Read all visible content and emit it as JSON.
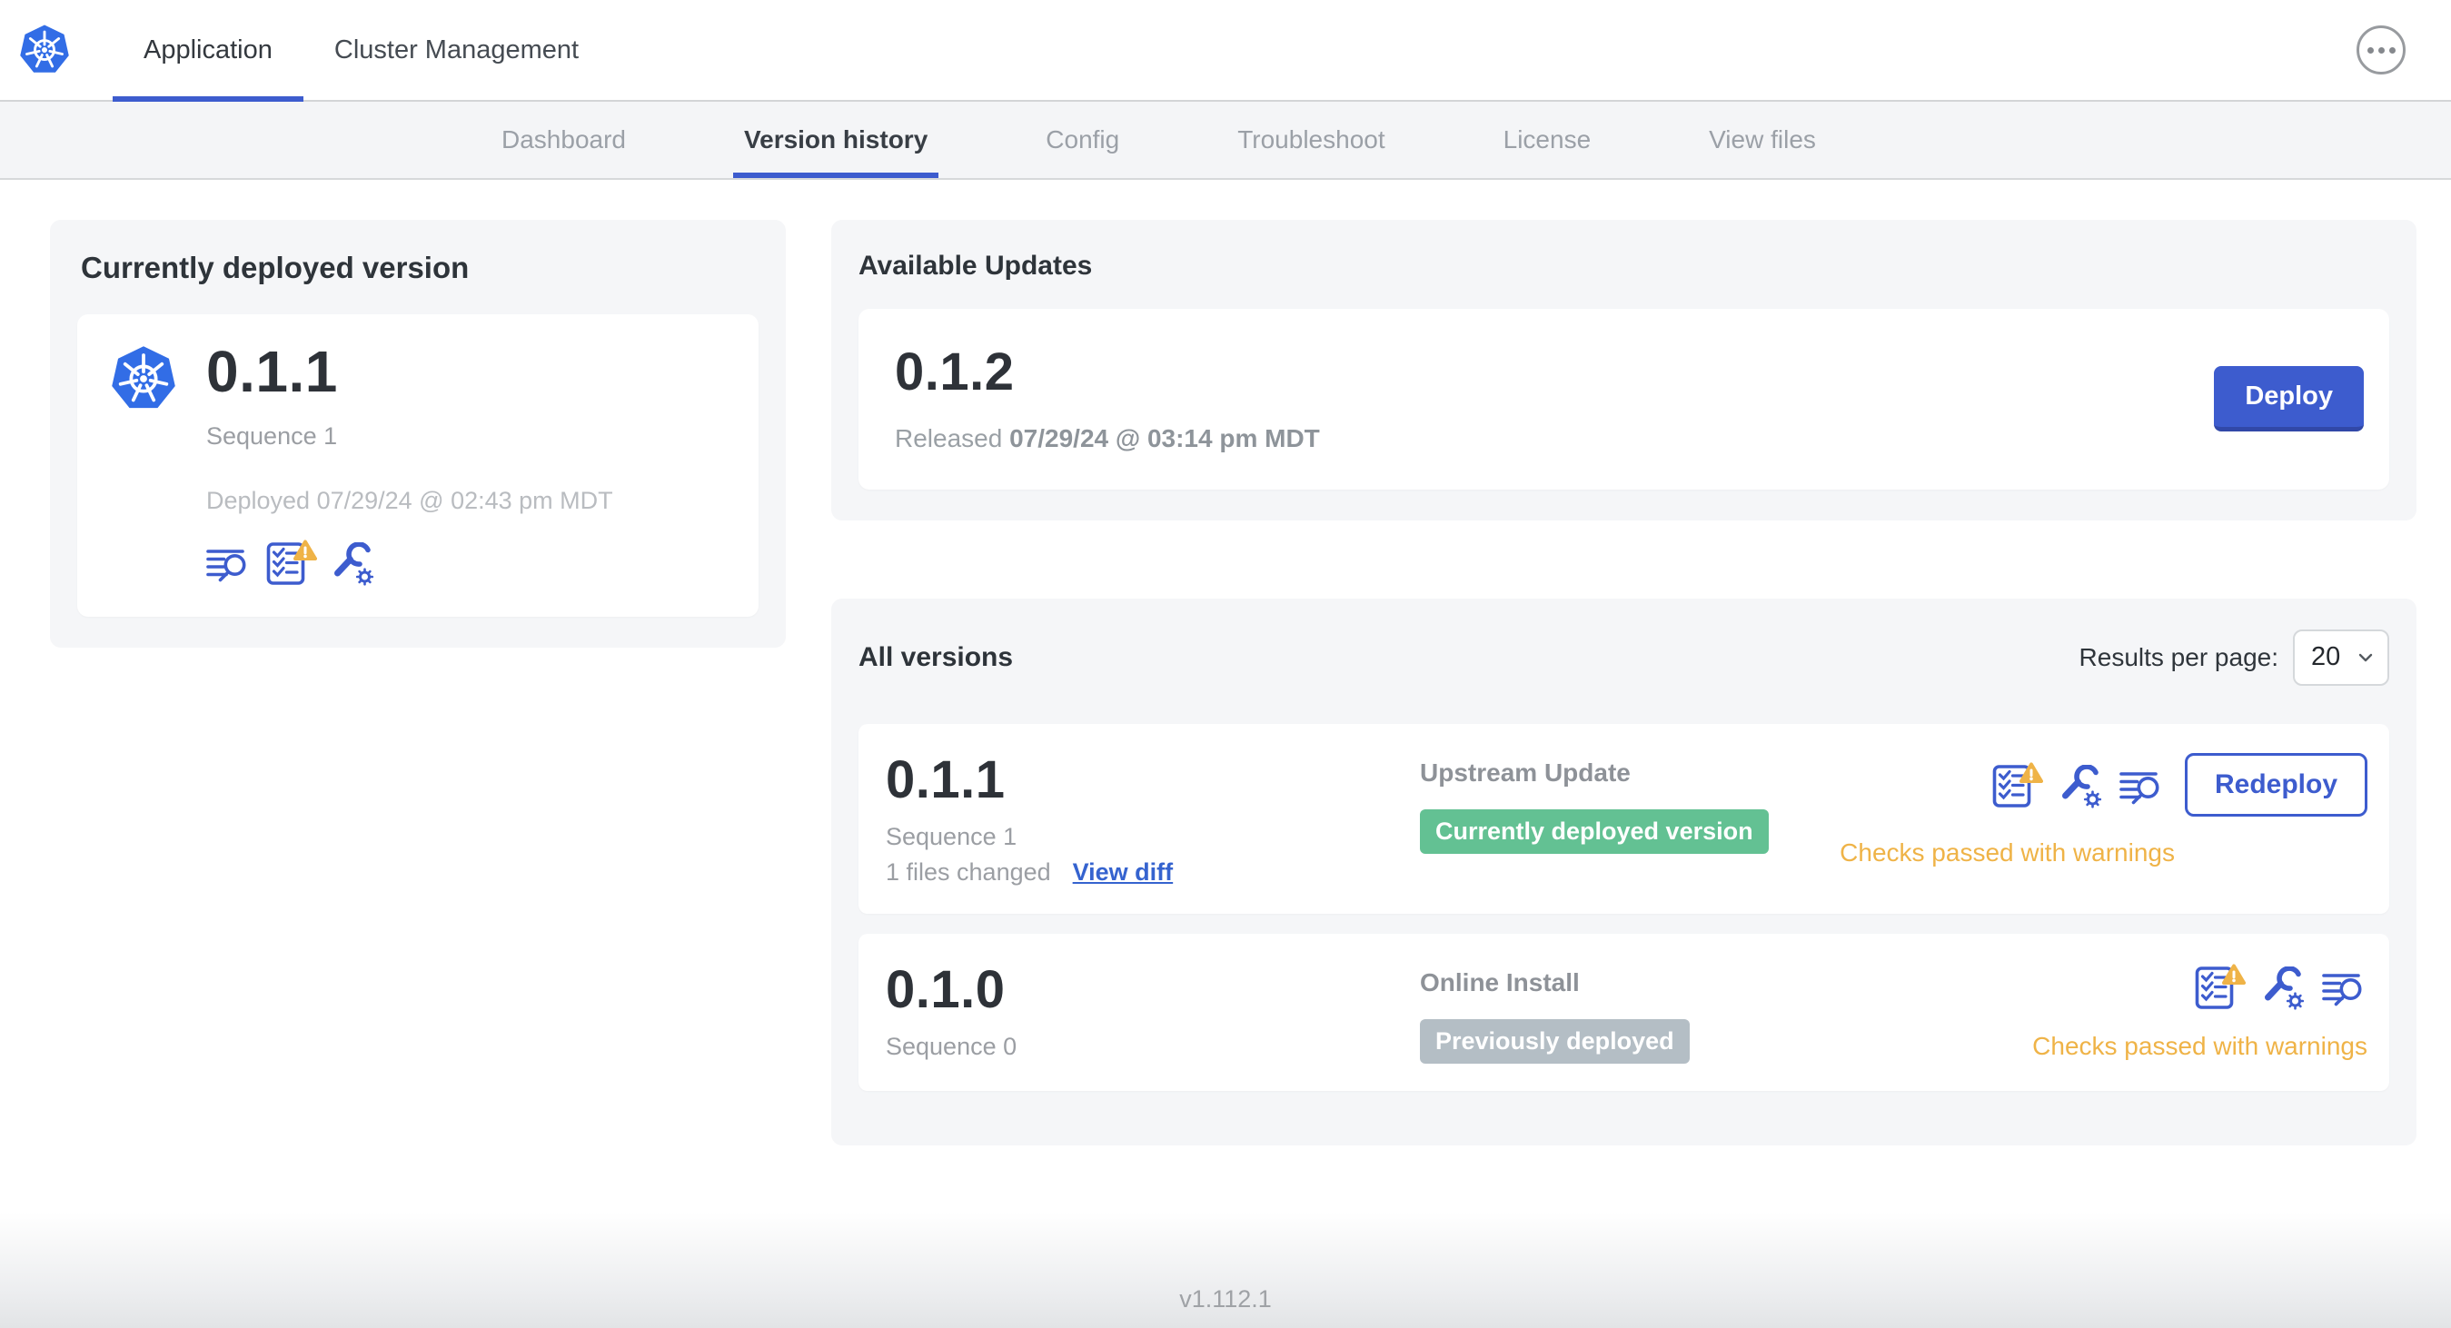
{
  "colors": {
    "accent_blue": "#3d5cce",
    "k8s_blue": "#326de6",
    "badge_green": "#63c193",
    "badge_gray": "#b4bec5",
    "warning_amber": "#efb347"
  },
  "header": {
    "tabs": [
      {
        "label": "Application",
        "active": true
      },
      {
        "label": "Cluster Management",
        "active": false
      }
    ]
  },
  "nav": {
    "tabs": [
      {
        "label": "Dashboard",
        "active": false
      },
      {
        "label": "Version history",
        "active": true
      },
      {
        "label": "Config",
        "active": false
      },
      {
        "label": "Troubleshoot",
        "active": false
      },
      {
        "label": "License",
        "active": false
      },
      {
        "label": "View files",
        "active": false
      }
    ]
  },
  "deployed_card": {
    "title": "Currently deployed version",
    "version": "0.1.1",
    "sequence": "Sequence 1",
    "deployed_at": "Deployed 07/29/24 @ 02:43 pm MDT",
    "icons": [
      "release-notes-icon",
      "preflight-checks-warning-icon",
      "edit-config-icon"
    ]
  },
  "available_updates": {
    "title": "Available Updates",
    "version": "0.1.2",
    "released_label": "Released",
    "released_at": "07/29/24 @ 03:14 pm MDT",
    "deploy_label": "Deploy"
  },
  "all_versions": {
    "title": "All versions",
    "results_per_page_label": "Results per page:",
    "results_per_page_value": "20",
    "rows": [
      {
        "version": "0.1.1",
        "sequence": "Sequence 1",
        "files_changed": "1 files changed",
        "view_diff_label": "View diff",
        "source": "Upstream Update",
        "status_badge": "Currently deployed version",
        "badge_style": "green",
        "action_label": "Redeploy",
        "checks_text": "Checks passed with warnings",
        "icons": [
          "preflight-checks-warning-icon",
          "edit-config-icon",
          "release-notes-icon"
        ]
      },
      {
        "version": "0.1.0",
        "sequence": "Sequence 0",
        "source": "Online Install",
        "status_badge": "Previously deployed",
        "badge_style": "gray",
        "checks_text": "Checks passed with warnings",
        "icons": [
          "preflight-checks-warning-icon",
          "edit-config-icon",
          "release-notes-icon"
        ]
      }
    ]
  },
  "footer": {
    "app_version": "v1.112.1"
  }
}
